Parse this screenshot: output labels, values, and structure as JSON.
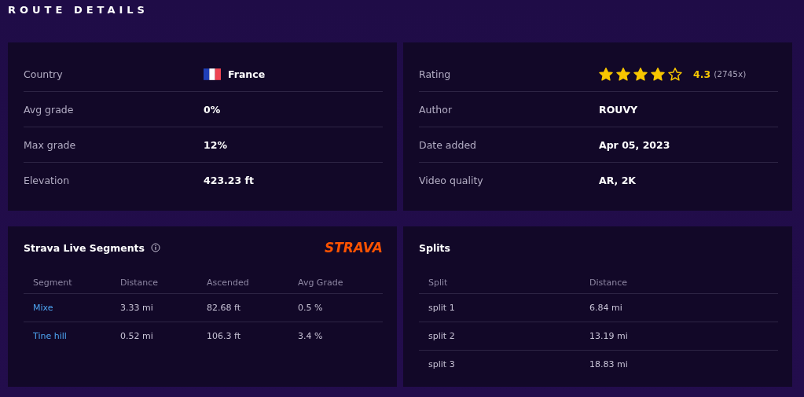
{
  "title": "ROUTE DETAILS",
  "details": [
    {
      "rows": [
        {
          "kind": "country",
          "label": "Country",
          "value": "France"
        },
        {
          "kind": "text",
          "label": "Avg grade",
          "value": "0%"
        },
        {
          "kind": "text",
          "label": "Max grade",
          "value": "12%"
        },
        {
          "kind": "text",
          "label": "Elevation",
          "value": "423.23 ft"
        }
      ]
    },
    {
      "rows": [
        {
          "kind": "rating",
          "label": "Rating",
          "stars": 4,
          "value": "4.3",
          "count": "(2745x)"
        },
        {
          "kind": "text",
          "label": "Author",
          "value": "ROUVY"
        },
        {
          "kind": "text",
          "label": "Date added",
          "value": "Apr 05, 2023"
        },
        {
          "kind": "text",
          "label": "Video quality",
          "value": "AR, 2K"
        }
      ]
    }
  ],
  "segments": {
    "title": "Strava Live Segments",
    "logo": "STRAVA",
    "columns": [
      "Segment",
      "Distance",
      "Ascended",
      "Avg Grade"
    ],
    "rows": [
      [
        "Mixe",
        "3.33 mi",
        "82.68 ft",
        "0.5 %"
      ],
      [
        "Tine hill",
        "0.52 mi",
        "106.3 ft",
        "3.4 %"
      ]
    ]
  },
  "splits": {
    "title": "Splits",
    "columns": [
      "Split",
      "Distance"
    ],
    "rows": [
      [
        "split 1",
        "6.84 mi"
      ],
      [
        "split 2",
        "13.19 mi"
      ],
      [
        "split 3",
        "18.83 mi"
      ]
    ]
  }
}
